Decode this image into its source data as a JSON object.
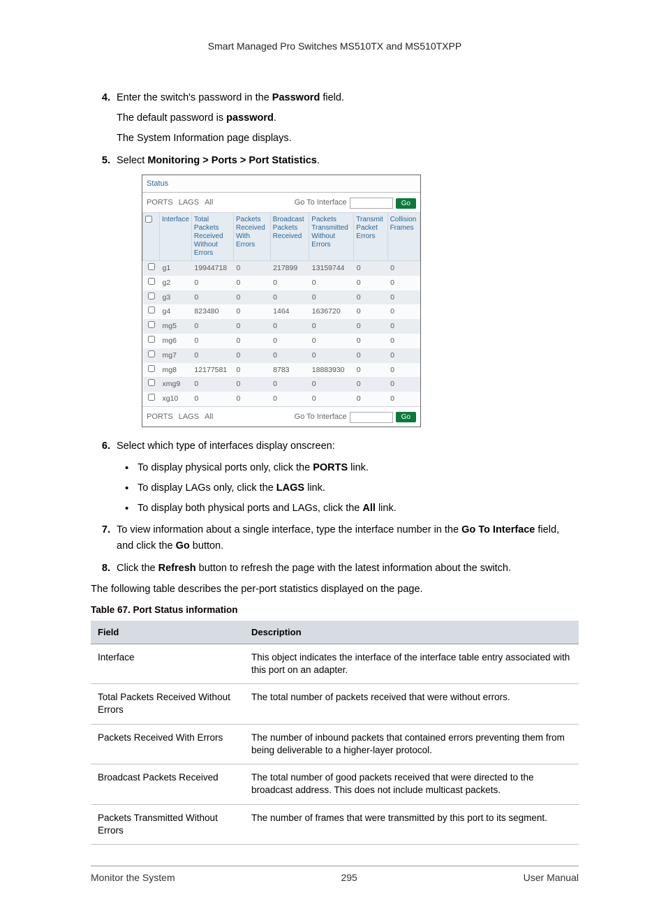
{
  "header": {
    "title": "Smart Managed Pro Switches MS510TX and MS510TXPP"
  },
  "steps": {
    "s4": {
      "num": "4.",
      "line1_a": "Enter the switch's password in the ",
      "line1_b": "Password",
      "line1_c": " field.",
      "line2_a": "The default password is ",
      "line2_b": "password",
      "line2_c": ".",
      "line3": "The System Information page displays."
    },
    "s5": {
      "num": "5.",
      "a": "Select ",
      "b": "Monitoring > Ports > Port Statistics",
      "c": "."
    },
    "s6": {
      "num": "6.",
      "intro": "Select which type of interfaces display onscreen:",
      "b1a": "To display physical ports only, click the ",
      "b1b": "PORTS",
      "b1c": " link.",
      "b2a": "To display LAGs only, click the ",
      "b2b": "LAGS",
      "b2c": " link.",
      "b3a": "To display both physical ports and LAGs, click the ",
      "b3b": "All",
      "b3c": " link."
    },
    "s7": {
      "num": "7.",
      "a": "To view information about a single interface, type the interface number in the ",
      "b": "Go To Interface",
      "c": " field, and click the ",
      "d": "Go",
      "e": " button."
    },
    "s8": {
      "num": "8.",
      "a": "Click the ",
      "b": "Refresh",
      "c": " button to refresh the page with the latest information about the switch."
    }
  },
  "body_para": "The following table describes the per-port statistics displayed on the page.",
  "table_caption": "Table 67.  Port Status information",
  "panel": {
    "status_label": "Status",
    "filter_ports": "PORTS",
    "filter_lags": "LAGS",
    "filter_all": "All",
    "goto_label": "Go To Interface",
    "go_label": "Go",
    "headers": [
      "Interface",
      "Total Packets Received Without Errors",
      "Packets Received With Errors",
      "Broadcast Packets Received",
      "Packets Transmitted Without Errors",
      "Transmit Packet Errors",
      "Collision Frames"
    ],
    "rows": [
      {
        "iface": "g1",
        "c1": "19944718",
        "c2": "0",
        "c3": "217899",
        "c4": "13159744",
        "c5": "0",
        "c6": "0"
      },
      {
        "iface": "g2",
        "c1": "0",
        "c2": "0",
        "c3": "0",
        "c4": "0",
        "c5": "0",
        "c6": "0"
      },
      {
        "iface": "g3",
        "c1": "0",
        "c2": "0",
        "c3": "0",
        "c4": "0",
        "c5": "0",
        "c6": "0"
      },
      {
        "iface": "g4",
        "c1": "823480",
        "c2": "0",
        "c3": "1464",
        "c4": "1636720",
        "c5": "0",
        "c6": "0"
      },
      {
        "iface": "mg5",
        "c1": "0",
        "c2": "0",
        "c3": "0",
        "c4": "0",
        "c5": "0",
        "c6": "0"
      },
      {
        "iface": "mg6",
        "c1": "0",
        "c2": "0",
        "c3": "0",
        "c4": "0",
        "c5": "0",
        "c6": "0"
      },
      {
        "iface": "mg7",
        "c1": "0",
        "c2": "0",
        "c3": "0",
        "c4": "0",
        "c5": "0",
        "c6": "0"
      },
      {
        "iface": "mg8",
        "c1": "12177581",
        "c2": "0",
        "c3": "8783",
        "c4": "18883930",
        "c5": "0",
        "c6": "0"
      },
      {
        "iface": "xmg9",
        "c1": "0",
        "c2": "0",
        "c3": "0",
        "c4": "0",
        "c5": "0",
        "c6": "0"
      },
      {
        "iface": "xg10",
        "c1": "0",
        "c2": "0",
        "c3": "0",
        "c4": "0",
        "c5": "0",
        "c6": "0"
      }
    ],
    "bottom_filter_ports": "PORTS",
    "bottom_filter_lags": "LAGS",
    "bottom_filter_all": "All",
    "bottom_goto": "Go To Interface",
    "bottom_go": "Go"
  },
  "info_table": {
    "head_field": "Field",
    "head_desc": "Description",
    "rows": [
      {
        "field": "Interface",
        "desc": "This object indicates the interface of the interface table entry associated with this port on an adapter."
      },
      {
        "field": "Total Packets Received Without Errors",
        "desc": "The total number of packets received that were without errors."
      },
      {
        "field": "Packets Received With Errors",
        "desc": "The number of inbound packets that contained errors preventing them from being deliverable to a higher-layer protocol."
      },
      {
        "field": "Broadcast Packets Received",
        "desc": "The total number of good packets received that were directed to the broadcast address. This does not include multicast packets."
      },
      {
        "field": "Packets Transmitted Without Errors",
        "desc": "The number of frames that were transmitted by this port to its segment."
      }
    ]
  },
  "footer": {
    "left": "Monitor the System",
    "center": "295",
    "right": "User Manual"
  }
}
